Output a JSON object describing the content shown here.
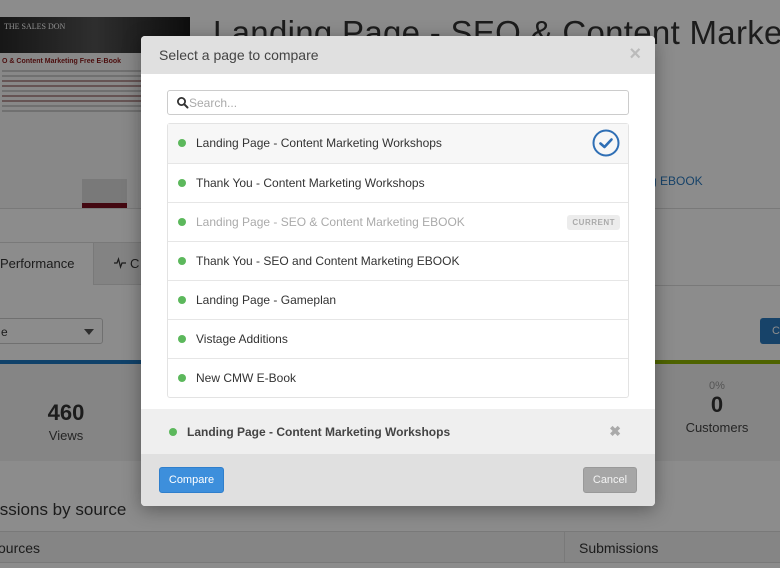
{
  "background": {
    "page_title": "Landing Page - SEO & Content Marketing ...",
    "thumbnail": {
      "logo": "THE SALES DON",
      "headline": "O & Content Marketing Free E-Book"
    },
    "link_text": "g EBOOK",
    "tabs": [
      {
        "label": "Performance"
      },
      {
        "label": "C",
        "icon": "pulse-icon"
      }
    ],
    "select_value": "e",
    "right_button_label": "C",
    "stats": [
      {
        "value": "460",
        "label": "Views",
        "percent": ""
      },
      {
        "value": "0",
        "label": "Customers",
        "percent": "0%"
      }
    ],
    "section_title": "issions by source",
    "table_headers": [
      "ources",
      "Submissions"
    ]
  },
  "modal": {
    "title": "Select a page to compare",
    "close_icon": "close-icon",
    "search": {
      "placeholder": "Search...",
      "value": ""
    },
    "pages": [
      {
        "name": "Landing Page - Content Marketing Workshops",
        "status": "active",
        "selected": true,
        "badge": ""
      },
      {
        "name": "Thank You - Content Marketing Workshops",
        "status": "active",
        "selected": false,
        "badge": ""
      },
      {
        "name": "Landing Page - SEO & Content Marketing EBOOK",
        "status": "active",
        "selected": false,
        "badge": "CURRENT"
      },
      {
        "name": "Thank You - SEO and Content Marketing EBOOK",
        "status": "active",
        "selected": false,
        "badge": ""
      },
      {
        "name": "Landing Page - Gameplan",
        "status": "active",
        "selected": false,
        "badge": ""
      },
      {
        "name": "Vistage Additions",
        "status": "active",
        "selected": false,
        "badge": ""
      },
      {
        "name": "New CMW E-Book",
        "status": "active",
        "selected": false,
        "badge": ""
      }
    ],
    "selected_page": "Landing Page - Content Marketing Workshops",
    "compare_label": "Compare",
    "cancel_label": "Cancel"
  },
  "colors": {
    "status_active": "#5cb85c",
    "primary": "#3d8fdc",
    "check": "#2f6fb5",
    "bar_blue": "#1e78c2",
    "bar_green": "#8fb500"
  }
}
